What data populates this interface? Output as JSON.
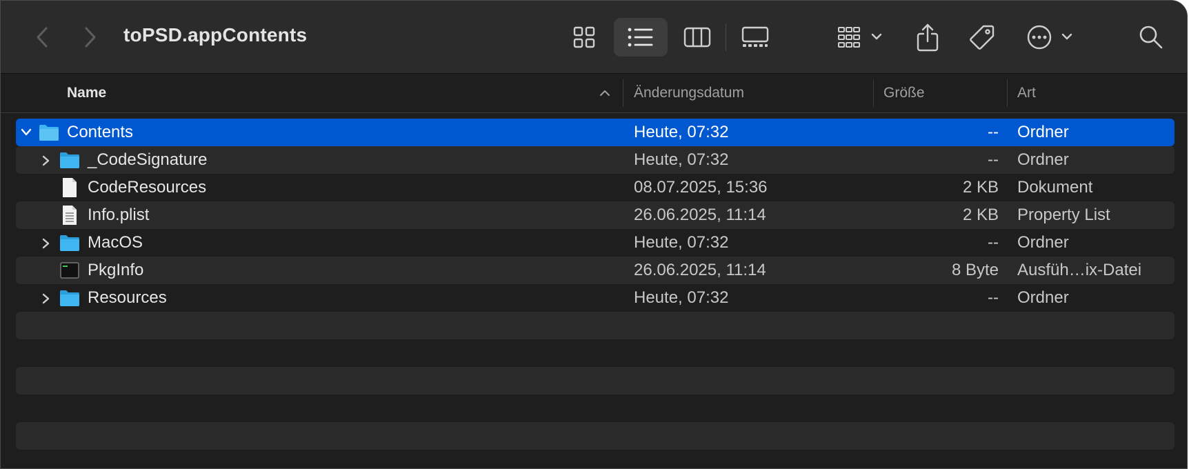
{
  "window": {
    "title": "toPSD.appContents"
  },
  "toolbar": {
    "back_icon": "chevron-left-icon",
    "forward_icon": "chevron-right-icon",
    "views": [
      "icon-view-icon",
      "list-view-icon",
      "column-view-icon",
      "gallery-view-icon"
    ],
    "selected_view": "list-view-icon",
    "actions": [
      "group-icon",
      "share-icon",
      "tag-icon",
      "more-icon",
      "search-icon"
    ]
  },
  "columns": {
    "name": "Name",
    "date": "Änderungsdatum",
    "size": "Größe",
    "kind": "Art"
  },
  "rows": [
    {
      "name": "Contents",
      "date": "Heute, 07:32",
      "size": "--",
      "kind": "Ordner",
      "type": "folder",
      "expanded": true,
      "selected": true
    },
    {
      "name": "_CodeSignature",
      "date": "Heute, 07:32",
      "size": "--",
      "kind": "Ordner",
      "type": "folder",
      "expanded": false
    },
    {
      "name": "CodeResources",
      "date": "08.07.2025, 15:36",
      "size": "2 KB",
      "kind": "Dokument",
      "type": "document"
    },
    {
      "name": "Info.plist",
      "date": "26.06.2025, 11:14",
      "size": "2 KB",
      "kind": "Property List",
      "type": "plist"
    },
    {
      "name": "MacOS",
      "date": "Heute, 07:32",
      "size": "--",
      "kind": "Ordner",
      "type": "folder",
      "expanded": false
    },
    {
      "name": "PkgInfo",
      "date": "26.06.2025, 11:14",
      "size": "8 Byte",
      "kind": "Ausfüh…ix-Datei",
      "type": "exec"
    },
    {
      "name": "Resources",
      "date": "Heute, 07:32",
      "size": "--",
      "kind": "Ordner",
      "type": "folder",
      "expanded": false
    }
  ],
  "colors": {
    "selection": "#0058d0",
    "folder": "#3fb6f2",
    "background": "#1e1e1e"
  }
}
